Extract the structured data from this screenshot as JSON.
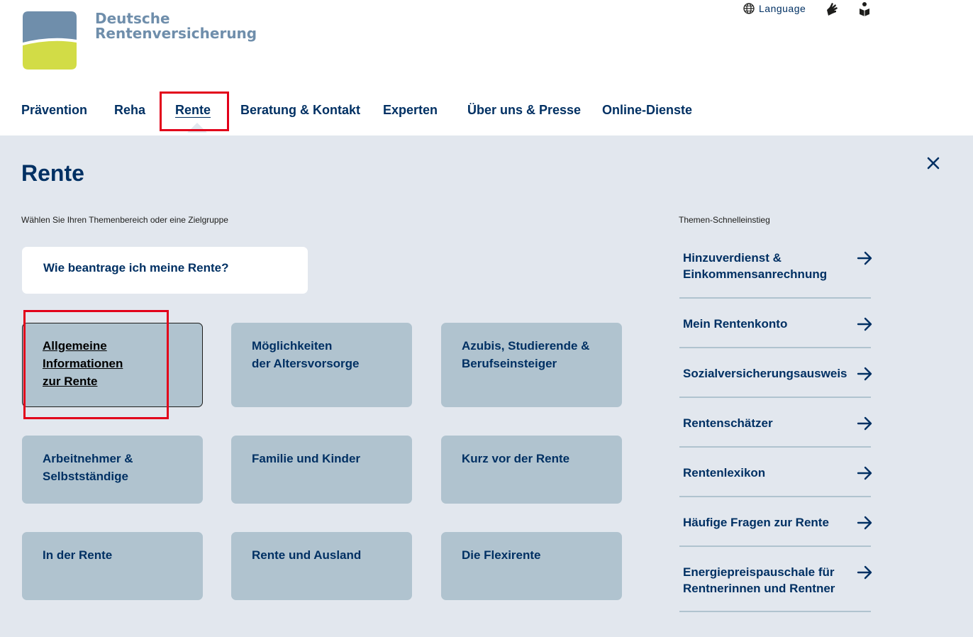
{
  "brand": {
    "line1": "Deutsche",
    "line2": "Rentenversicherung"
  },
  "utility": {
    "language_label": "Language",
    "sign_language_icon": "hand-sign-icon",
    "easy_language_icon": "easy-language-icon"
  },
  "nav": {
    "items": [
      {
        "label": "Prävention"
      },
      {
        "label": "Reha"
      },
      {
        "label": "Rente",
        "active": true
      },
      {
        "label": "Beratung & Kontakt"
      },
      {
        "label": "Experten"
      },
      {
        "label": "Über uns & Presse"
      },
      {
        "label": "Online-Dienste"
      }
    ]
  },
  "panel": {
    "title": "Rente",
    "hint_left": "Wählen Sie Ihren Themenbereich oder eine Zielgruppe",
    "hint_right": "Themen-Schnelleinstieg",
    "featured": "Wie beantrage ich meine Rente?",
    "tiles": [
      {
        "line1": "Allgemeine ",
        "line2": "Informationen ",
        "line3": "zur Rente"
      },
      {
        "line1": "Möglichkeiten",
        "line2": "der Altersvorsorge"
      },
      {
        "line1": "Azubis, Studierende &",
        "line2": "Berufseinsteiger"
      },
      {
        "line1": "Arbeitnehmer &",
        "line2": "Selbstständige"
      },
      {
        "line1": "Familie und Kinder"
      },
      {
        "line1": "Kurz vor der Rente"
      },
      {
        "line1": "In der Rente"
      },
      {
        "line1": "Rente und Ausland"
      },
      {
        "line1": "Die Flexirente"
      }
    ],
    "quick_links": [
      {
        "line1": "Hinzuverdienst &",
        "line2": "Einkommensanrechnung"
      },
      {
        "line1": "Mein Rentenkonto"
      },
      {
        "line1": "Sozialversicherungsausweis"
      },
      {
        "line1": "Rentenschätzer"
      },
      {
        "line1": "Rentenlexikon"
      },
      {
        "line1": "Häufige Fragen zur Rente"
      },
      {
        "line1": "Energiepreispauschale für",
        "line2": "Rentnerinnen und Rentner"
      }
    ]
  },
  "colors": {
    "primary": "#003063",
    "panel_bg": "#e2e7ee",
    "tile_bg": "#b0c3cf",
    "highlight": "#e2001a",
    "logo_blue": "#6f8eab",
    "logo_green": "#d2dc46"
  }
}
